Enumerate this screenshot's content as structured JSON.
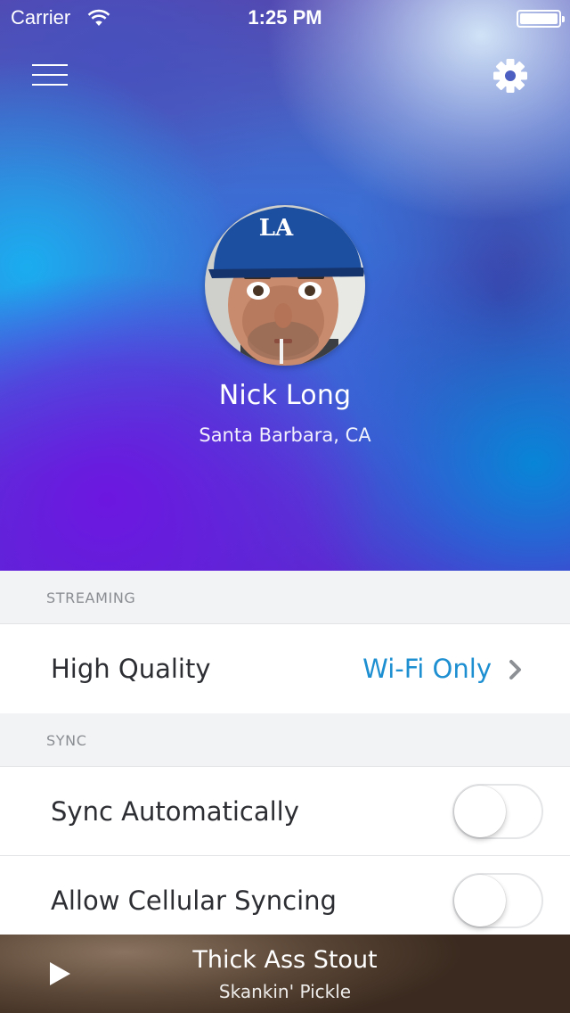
{
  "status_bar": {
    "carrier": "Carrier",
    "time": "1:25 PM",
    "battery_level": 1.0
  },
  "header": {
    "menu_icon": "hamburger-menu-icon",
    "settings_icon": "gear-icon"
  },
  "profile": {
    "name": "Nick Long",
    "location": "Santa Barbara, CA"
  },
  "streaming": {
    "header": "STREAMING",
    "rows": [
      {
        "label": "High Quality",
        "value": "Wi-Fi Only"
      }
    ]
  },
  "sync": {
    "header": "SYNC",
    "rows": [
      {
        "label": "Sync Automatically",
        "enabled": false
      },
      {
        "label": "Allow Cellular Syncing",
        "enabled": false
      }
    ]
  },
  "now_playing": {
    "title": "Thick Ass Stout",
    "artist": "Skankin' Pickle",
    "control_icon": "play-icon"
  },
  "colors": {
    "accent": "#1e90d2",
    "section_background": "#f2f3f5",
    "row_text": "#2c2e33"
  }
}
